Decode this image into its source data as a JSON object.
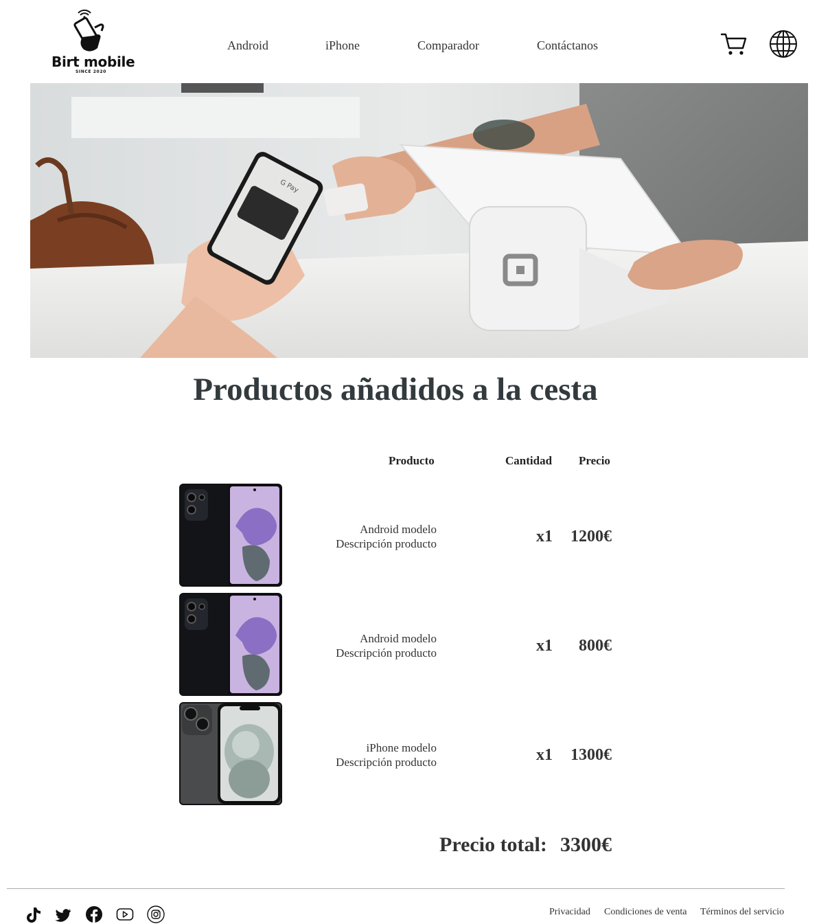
{
  "brand": {
    "name": "Birt mobile",
    "tagline": "SINCE 2020"
  },
  "nav": {
    "items": [
      "Android",
      "iPhone",
      "Comparador",
      "Contáctanos"
    ]
  },
  "header_icons": [
    "cart-icon",
    "globe-icon"
  ],
  "page_title": "Productos añadidos a la cesta",
  "table": {
    "headers": {
      "product": "Producto",
      "quantity": "Cantidad",
      "price": "Precio"
    },
    "rows": [
      {
        "name": "Android modelo",
        "description": "Descripción producto",
        "quantity": "x1",
        "price": "1200€",
        "image": "android-phone"
      },
      {
        "name": "Android modelo",
        "description": "Descripción producto",
        "quantity": "x1",
        "price": "800€",
        "image": "android-phone"
      },
      {
        "name": "iPhone modelo",
        "description": "Descripción producto",
        "quantity": "x1",
        "price": "1300€",
        "image": "iphone"
      }
    ]
  },
  "total": {
    "label": "Precio total:",
    "value": "3300€"
  },
  "footer": {
    "social": [
      "tiktok-icon",
      "twitter-icon",
      "facebook-icon",
      "youtube-icon",
      "instagram-icon"
    ],
    "links": [
      "Privacidad",
      "Condiciones de venta",
      "Términos del servicio"
    ]
  },
  "hero_screen_label": "G Pay"
}
